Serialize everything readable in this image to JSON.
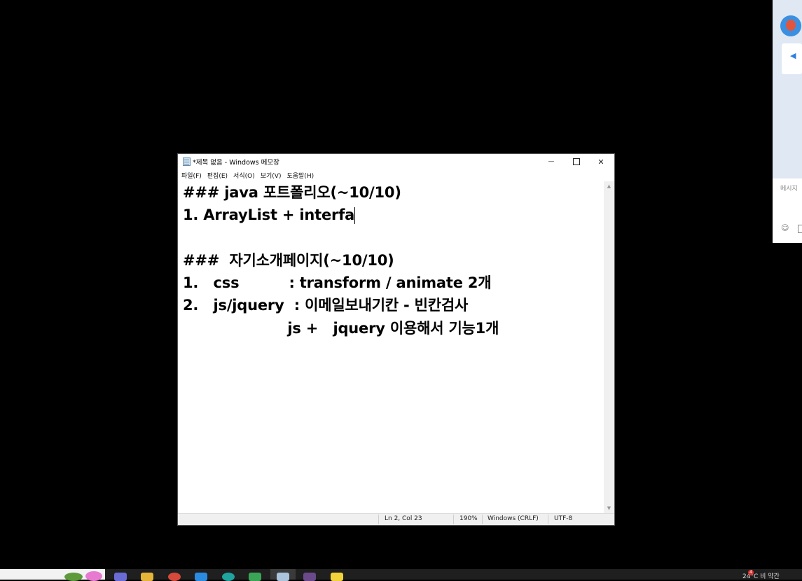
{
  "window": {
    "title": "*제목 없음 - Windows 메모장",
    "min_symbol": "—",
    "close_symbol": "✕"
  },
  "menu": [
    "파일(F)",
    "편집(E)",
    "서식(O)",
    "보기(V)",
    "도움말(H)"
  ],
  "editor": {
    "lines": [
      "### java 포트폴리오(~10/10)",
      "1. ArrayList + interfa",
      "",
      "###  자기소개페이지(~10/10)",
      "1.   css          : transform / animate 2개",
      "2.   js/jquery  : 이메일보내기칸 - 빈칸검사",
      "                     js +   jquery 이용해서 기능1개"
    ]
  },
  "statusbar": {
    "position": "Ln 2, Col 23",
    "zoom": "190%",
    "line_ending": "Windows (CRLF)",
    "encoding": "UTF-8"
  },
  "side_panel": {
    "message_label": "메시지",
    "emoji_symbol": "☺",
    "notice_icon": "megaphone-icon"
  },
  "taskbar": {
    "tray_text": "24°C  비 약간",
    "notification_count": "4"
  },
  "colors": {
    "accent_blue": "#2d7fe0",
    "taskbar_bg": "#1f1f1f"
  }
}
